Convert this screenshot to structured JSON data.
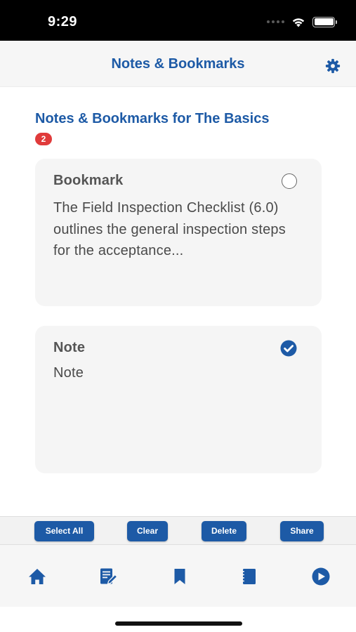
{
  "status_bar": {
    "time": "9:29"
  },
  "header": {
    "title": "Notes & Bookmarks",
    "settings_icon": "gear-icon"
  },
  "section": {
    "title": "Notes & Bookmarks for The Basics",
    "count": "2"
  },
  "items": [
    {
      "type": "Bookmark",
      "text": "The Field Inspection Checklist (6.0) outlines the general inspection steps for the acceptance...",
      "selected": false
    },
    {
      "type": "Note",
      "text": "Note",
      "selected": true
    }
  ],
  "actions": {
    "select_all": "Select All",
    "clear": "Clear",
    "delete": "Delete",
    "share": "Share"
  },
  "tab_bar": {
    "icons": [
      "home-icon",
      "notes-icon",
      "bookmark-icon",
      "contents-icon",
      "play-icon"
    ]
  },
  "colors": {
    "accent": "#1d5aa6",
    "badge": "#e03b3b",
    "card_background": "#f5f5f5"
  }
}
